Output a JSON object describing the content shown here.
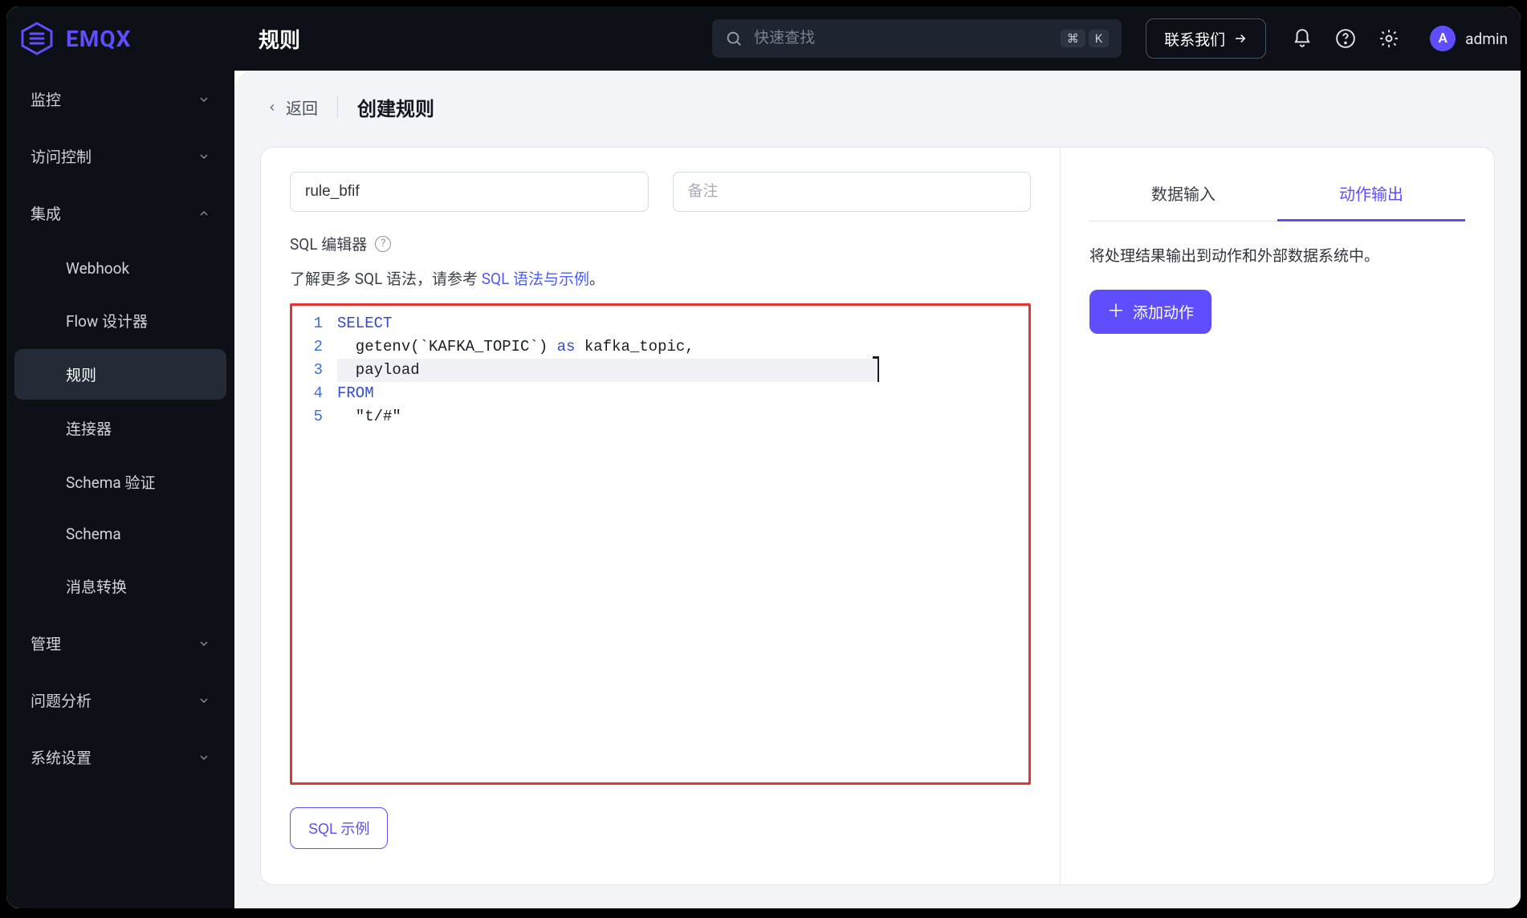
{
  "brand": "EMQX",
  "header": {
    "page_title": "规则",
    "search_placeholder": "快速查找",
    "kbd1": "⌘",
    "kbd2": "K",
    "contact": "联系我们",
    "username": "admin",
    "avatar_letter": "A"
  },
  "sidebar": {
    "sections": [
      {
        "label": "监控",
        "expanded": false
      },
      {
        "label": "访问控制",
        "expanded": false
      },
      {
        "label": "集成",
        "expanded": true,
        "items": [
          {
            "label": "Webhook"
          },
          {
            "label": "Flow 设计器"
          },
          {
            "label": "规则",
            "active": true
          },
          {
            "label": "连接器"
          },
          {
            "label": "Schema 验证"
          },
          {
            "label": "Schema"
          },
          {
            "label": "消息转换"
          }
        ]
      },
      {
        "label": "管理",
        "expanded": false
      },
      {
        "label": "问题分析",
        "expanded": false
      },
      {
        "label": "系统设置",
        "expanded": false
      }
    ]
  },
  "crumb": {
    "back": "返回",
    "title": "创建规则"
  },
  "form": {
    "name_value": "rule_bfif",
    "note_placeholder": "备注",
    "editor_label": "SQL 编辑器",
    "hint_prefix": "了解更多 SQL 语法，请参考 ",
    "hint_link": "SQL 语法与示例",
    "hint_suffix": "。",
    "sql_example_btn": "SQL 示例"
  },
  "sql": {
    "lines": [
      {
        "n": "1",
        "tokens": [
          {
            "t": "SELECT",
            "cls": "kw"
          }
        ]
      },
      {
        "n": "2",
        "tokens": [
          {
            "t": "  getenv(`KAFKA_TOPIC`) ",
            "cls": ""
          },
          {
            "t": "as",
            "cls": "kw2"
          },
          {
            "t": " kafka_topic,",
            "cls": ""
          }
        ]
      },
      {
        "n": "3",
        "tokens": [
          {
            "t": "  payload",
            "cls": ""
          }
        ],
        "cursor": true
      },
      {
        "n": "4",
        "tokens": [
          {
            "t": "FROM",
            "cls": "kw"
          }
        ]
      },
      {
        "n": "5",
        "tokens": [
          {
            "t": "  \"t/#\"",
            "cls": "str"
          }
        ]
      }
    ]
  },
  "right": {
    "tab_input": "数据输入",
    "tab_output": "动作输出",
    "desc": "将处理结果输出到动作和外部数据系统中。",
    "add_action": "添加动作"
  }
}
